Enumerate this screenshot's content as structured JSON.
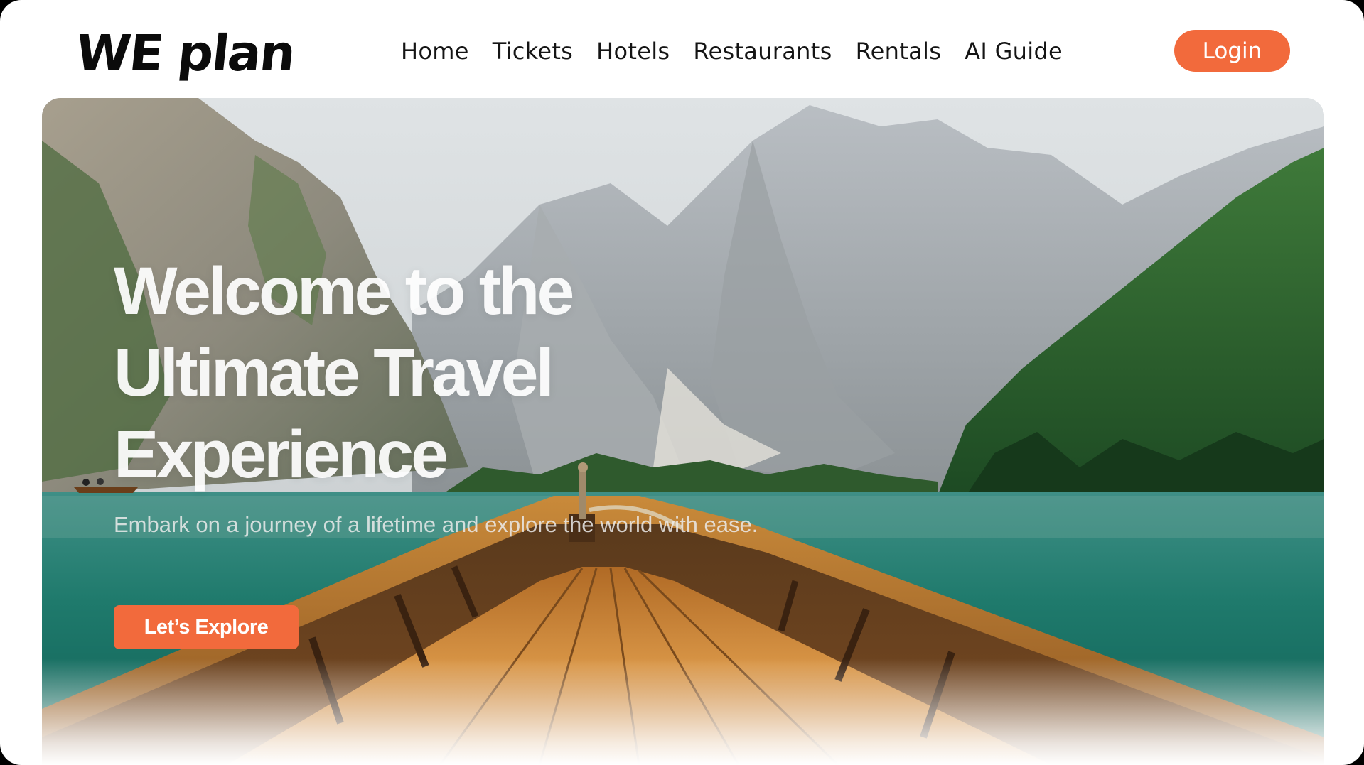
{
  "brand": {
    "logo_text": "WE plan"
  },
  "nav": {
    "items": [
      {
        "label": "Home"
      },
      {
        "label": "Tickets"
      },
      {
        "label": "Hotels"
      },
      {
        "label": "Restaurants"
      },
      {
        "label": "Rentals"
      },
      {
        "label": "AI Guide"
      }
    ],
    "login_label": "Login"
  },
  "hero": {
    "title": "Welcome to the Ultimate Travel Experience",
    "subtitle": "Embark on a journey of a lifetime and explore the world with ease.",
    "cta_label": "Let’s Explore"
  },
  "colors": {
    "accent": "#f26a3c",
    "text_dark": "#141414",
    "background": "#ffffff"
  }
}
